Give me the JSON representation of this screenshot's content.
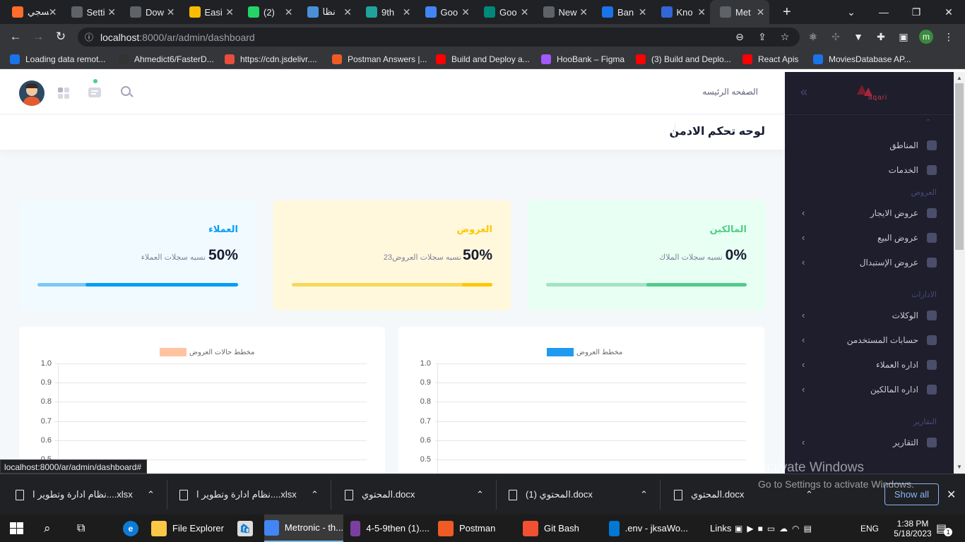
{
  "browser": {
    "tabs": [
      {
        "label": "تسجي",
        "icon": "cpanel-icon",
        "color": "#ff6c2c",
        "left": 0
      },
      {
        "label": "Setti",
        "icon": "settings-icon",
        "color": "#5f6368"
      },
      {
        "label": "Dow",
        "icon": "download-icon",
        "color": "#5f6368"
      },
      {
        "label": "Easi",
        "icon": "easi-icon",
        "color": "#fbbc04"
      },
      {
        "label": "(2)",
        "icon": "whatsapp-icon",
        "color": "#25d366"
      },
      {
        "label": "نظا",
        "icon": "app-icon",
        "color": "#4a90d9"
      },
      {
        "label": "9th",
        "icon": "globe-icon",
        "color": "#1fa39a"
      },
      {
        "label": "Goo",
        "icon": "google-translate-icon",
        "color": "#4285f4"
      },
      {
        "label": "Goo",
        "icon": "google-meet-icon",
        "color": "#00897b"
      },
      {
        "label": "New",
        "icon": "chrome-icon",
        "color": "#5f6368"
      },
      {
        "label": "Ban",
        "icon": "bank-icon",
        "color": "#1a73e8"
      },
      {
        "label": "Kno",
        "icon": "knowledge-icon",
        "color": "#3367d6"
      },
      {
        "label": "Met",
        "icon": "globe-icon",
        "color": "#5f6368"
      }
    ],
    "new_tab": "+",
    "url_host": "localhost",
    "url_path": ":8000/ar/admin/dashboard",
    "profile_letter": "m",
    "bookmarks": [
      {
        "label": "Loading data remot...",
        "color": "#1a73e8"
      },
      {
        "label": "Ahmedict6/FasterD...",
        "color": "#333"
      },
      {
        "label": "https://cdn.jsdelivr....",
        "color": "#e84d3d"
      },
      {
        "label": "Postman Answers |...",
        "color": "#ef5b25"
      },
      {
        "label": "Build and Deploy a...",
        "color": "#ff0000"
      },
      {
        "label": "HooBank – Figma",
        "color": "#a259ff"
      },
      {
        "label": "(3) Build and Deplo...",
        "color": "#ff0000"
      },
      {
        "label": "React Apis",
        "color": "#ff0000"
      },
      {
        "label": "MoviesDatabase AP...",
        "color": "#1a73e8"
      }
    ],
    "status_link": "localhost:8000/ar/admin/dashboard#"
  },
  "sidebar": {
    "logo_text": "aqari",
    "items": [
      {
        "label": "المناطق",
        "chevron": false
      },
      {
        "label": "الخدمات",
        "chevron": false
      },
      {
        "section": "العروض"
      },
      {
        "label": "عروض الايجار",
        "chevron": true
      },
      {
        "label": "عروض البيع",
        "chevron": true
      },
      {
        "label": "عروض الإستبدال",
        "chevron": true
      },
      {
        "section": "الادارات"
      },
      {
        "label": "الوكلات",
        "chevron": true
      },
      {
        "label": "حسابات المستخدمن",
        "chevron": true
      },
      {
        "label": "اداره العملاء",
        "chevron": true
      },
      {
        "label": "اداره المالكين",
        "chevron": true
      },
      {
        "section": "التقارير"
      },
      {
        "label": "التقارير",
        "chevron": true
      }
    ]
  },
  "header": {
    "breadcrumb": "الصفحه الرئيسه",
    "page_title": "لوحه تحكم الادمن"
  },
  "cards": [
    {
      "title": "العملاء",
      "percent": "50%",
      "desc": "نسبه سجلات العملاء",
      "count": "",
      "bg": "#f1faff",
      "accent": "#009ef7",
      "track": "#7cc8f5",
      "progress": 0.76
    },
    {
      "title": "العروض",
      "percent": "50%",
      "desc": "نسبه سجلات العروض",
      "count": "23",
      "bg": "#fff8dd",
      "accent": "#ffc700",
      "track": "#f6d95a",
      "progress": 0.15
    },
    {
      "title": "المالكين",
      "percent": "0%",
      "desc": "نسبه سجلات الملاك",
      "count": "",
      "bg": "#e8fff3",
      "accent": "#50cd89",
      "track": "#a3e3c2",
      "progress": 0.5
    }
  ],
  "charts": [
    {
      "legend": "مخطط حالات العروض",
      "legend_color": "#ffc3a0"
    },
    {
      "legend": "مخطط العروض",
      "legend_color": "#1e9bf0"
    }
  ],
  "chart_data": [
    {
      "type": "bar",
      "title": "",
      "series": [
        {
          "name": "مخطط حالات العروض",
          "values": []
        }
      ],
      "y_ticks": [
        "1.0",
        "0.9",
        "0.8",
        "0.7",
        "0.6",
        "0.5"
      ],
      "ylim": [
        0.5,
        1.0
      ]
    },
    {
      "type": "bar",
      "title": "",
      "series": [
        {
          "name": "مخطط العروض",
          "values": []
        }
      ],
      "y_ticks": [
        "1.0",
        "0.9",
        "0.8",
        "0.7",
        "0.6",
        "0.5"
      ],
      "ylim": [
        0.5,
        1.0
      ]
    }
  ],
  "downloads": [
    {
      "label": "نظام ادارة وتطوير ا....xlsx"
    },
    {
      "label": "نظام ادارة وتطوير ا....xlsx"
    },
    {
      "label": "المحتوي.docx"
    },
    {
      "label": "المحتوي (1).docx"
    },
    {
      "label": "المحتوي.docx"
    }
  ],
  "show_all": "Show all",
  "activate": {
    "line1": "Activate Windows",
    "line2": "Go to Settings to activate Windows."
  },
  "taskbar": {
    "apps": [
      {
        "label": "File Explorer",
        "color": "#f9c846"
      },
      {
        "label": "Metronic - th...",
        "color": "#4285f4"
      },
      {
        "label": "4-5-9then (1)....",
        "color": "#7b3fa0"
      },
      {
        "label": "Postman",
        "color": "#ef5b25"
      },
      {
        "label": "Git Bash",
        "color": "#f05133"
      },
      {
        "label": ".env - jksaWo...",
        "color": "#0078d4"
      }
    ],
    "links": "Links",
    "lang": "ENG",
    "time": "1:38 PM",
    "date": "5/18/2023",
    "notif_count": "1"
  }
}
